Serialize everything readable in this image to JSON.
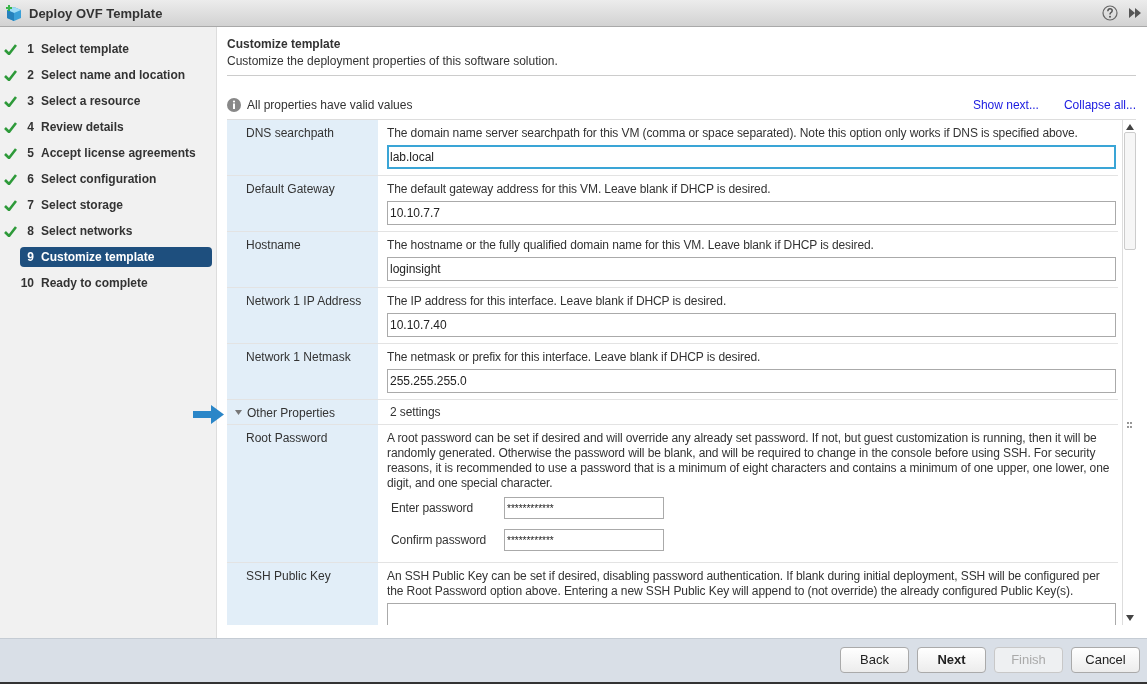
{
  "window": {
    "title": "Deploy OVF Template"
  },
  "steps": [
    {
      "number": "1",
      "label": "Select template",
      "completed": true,
      "selected": false
    },
    {
      "number": "2",
      "label": "Select name and location",
      "completed": true,
      "selected": false
    },
    {
      "number": "3",
      "label": "Select a resource",
      "completed": true,
      "selected": false
    },
    {
      "number": "4",
      "label": "Review details",
      "completed": true,
      "selected": false
    },
    {
      "number": "5",
      "label": "Accept license agreements",
      "completed": true,
      "selected": false
    },
    {
      "number": "6",
      "label": "Select configuration",
      "completed": true,
      "selected": false
    },
    {
      "number": "7",
      "label": "Select storage",
      "completed": true,
      "selected": false
    },
    {
      "number": "8",
      "label": "Select networks",
      "completed": true,
      "selected": false
    },
    {
      "number": "9",
      "label": "Customize template",
      "completed": false,
      "selected": true
    },
    {
      "number": "10",
      "label": "Ready to complete",
      "completed": false,
      "selected": false
    }
  ],
  "page": {
    "title": "Customize template",
    "subtitle": "Customize the deployment properties of this software solution."
  },
  "status": {
    "message": "All properties have valid values"
  },
  "links": [
    "Show next...",
    "Collapse all..."
  ],
  "properties": [
    {
      "kind": "text",
      "label": "DNS searchpath",
      "description": "The domain name server searchpath for this VM (comma or space separated). Note this option only works if DNS is specified above.",
      "value": "lab.local",
      "focused": true
    },
    {
      "kind": "text",
      "label": "Default Gateway",
      "description": "The default gateway address for this VM. Leave blank if DHCP is desired.",
      "value": "10.10.7.7",
      "focused": false
    },
    {
      "kind": "text",
      "label": "Hostname",
      "description": "The hostname or the fully qualified domain name for this VM. Leave blank if DHCP is desired.",
      "value": "loginsight",
      "focused": false
    },
    {
      "kind": "text",
      "label": "Network 1 IP Address",
      "description": "The IP address for this interface. Leave blank if DHCP is desired.",
      "value": "10.10.7.40",
      "focused": false
    },
    {
      "kind": "text",
      "label": "Network 1 Netmask",
      "description": "The netmask or prefix for this interface. Leave blank if DHCP is desired.",
      "value": "255.255.255.0",
      "focused": false
    },
    {
      "kind": "group",
      "label": "Other Properties",
      "summary": "2 settings",
      "expanded": true
    },
    {
      "kind": "password",
      "label": "Root Password",
      "description": "A root password can be set if desired and will override any already set password. If not, but guest customization is running, then it will be randomly generated. Otherwise the password will be blank, and will be required to change in the console before using SSH. For security reasons, it is recommended to use a password that is a minimum of eight characters and contains a minimum of one upper, one lower, one digit, and one special character.",
      "fields": [
        {
          "label": "Enter password",
          "value": "************"
        },
        {
          "label": "Confirm password",
          "value": "************"
        }
      ]
    },
    {
      "kind": "text",
      "label": "SSH Public Key",
      "description": "An SSH Public Key can be set if desired, disabling password authentication. If blank during initial deployment, SSH will be configured per the Root Password option above. Entering a new SSH Public Key will append to (not override) the already configured Public Key(s).",
      "focused": false
    }
  ],
  "buttons": [
    {
      "label": "Back",
      "primary": false,
      "disabled": false
    },
    {
      "label": "Next",
      "primary": true,
      "disabled": false
    },
    {
      "label": "Finish",
      "primary": false,
      "disabled": true
    },
    {
      "label": "Cancel",
      "primary": false,
      "disabled": false
    }
  ]
}
